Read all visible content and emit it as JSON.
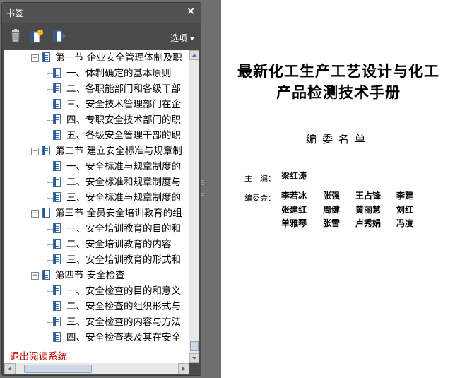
{
  "panel": {
    "title": "书签",
    "close_glyph": "×",
    "options_label": "选项",
    "toolbar_icons": [
      "trash-icon",
      "new-bookmark-icon",
      "expand-bookmark-icon"
    ]
  },
  "tree": {
    "sections": [
      {
        "label": "第一节 企业安全管理体制及职",
        "items": [
          "一、体制确定的基本原则",
          "二、各职能部门和各级干部",
          "三、安全技术管理部门在企",
          "四、专职安全技术部门的职",
          "五、各级安全管理干部的职"
        ]
      },
      {
        "label": "第二节 建立安全标准与规章制",
        "items": [
          "一、安全标准与规章制度的",
          "二、安全标准和规章制度与",
          "三、安全标准与规章制度的"
        ]
      },
      {
        "label": "第三节 全员安全培训教育的组",
        "items": [
          "一、安全培训教育的目的和",
          "二、安全培训教育的内容",
          "三、安全培训教育的形式和"
        ]
      },
      {
        "label": "第四节 安全检查",
        "items": [
          "一、安全检查的目的和意义",
          "二、安全检查的组织形式与",
          "三、安全检查的内容与方法",
          "四、安全检查表及其在安全"
        ]
      }
    ],
    "exit_label": "退出阅读系统"
  },
  "document": {
    "title_line1": "最新化工生产工艺设计与化工",
    "title_line2": "产品检测技术手册",
    "subtitle": "编委名单",
    "editor_label": "主　编：",
    "editor_name": "梁红涛",
    "committee_label": "编委会：",
    "committee_members": [
      "李若冰",
      "张强",
      "王占锋",
      "李建",
      "张建红",
      "周健",
      "黄丽慧",
      "刘红",
      "单雅琴",
      "张雪",
      "卢秀娟",
      "冯凌"
    ]
  }
}
